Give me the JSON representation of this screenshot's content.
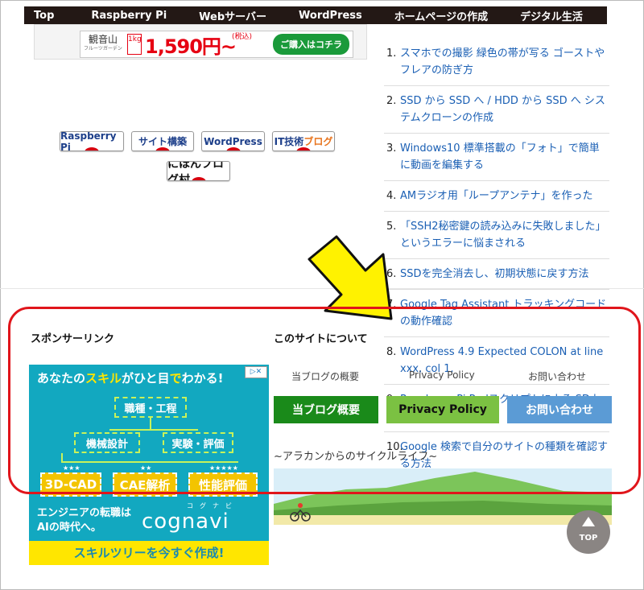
{
  "nav": {
    "items": [
      "Top",
      "Raspberry Pi",
      "Webサーバー",
      "WordPress",
      "ホームページの作成",
      "デジタル生活"
    ]
  },
  "top_ad": {
    "brand": "観音山",
    "brand_sub": "フルーツガーデン",
    "unit": "1kg",
    "price": "1,590円~",
    "tax": "(税込)",
    "buy_button": "ご購入はコチラ"
  },
  "badges": [
    "Raspberry Pi",
    "サイト構築",
    "WordPress",
    "IT技術",
    "ブログ",
    "にほんブログ村"
  ],
  "ranking": [
    {
      "num": "1.",
      "text": "スマホでの撮影 緑色の帯が写る ゴーストやフレアの防ぎ方"
    },
    {
      "num": "2.",
      "text": "SSD から SSD へ / HDD から SSD へ システムクローンの作成"
    },
    {
      "num": "3.",
      "text": "Windows10 標準搭載の「フォト」で簡単に動画を編集する"
    },
    {
      "num": "4.",
      "text": "AMラジオ用「ループアンテナ」を作った"
    },
    {
      "num": "5.",
      "text": "「SSH2秘密鍵の読み込みに失敗しました」というエラーに悩まされる"
    },
    {
      "num": "6.",
      "text": "SSDを完全消去し、初期状態に戻す方法"
    },
    {
      "num": "7.",
      "text": "Google Tag Assistant トラッキングコードの動作確認"
    },
    {
      "num": "8.",
      "text": "WordPress 4.9 Expected COLON at line xxx, col 1."
    },
    {
      "num": "9.",
      "text": "Raspberry Pi Perlスクリプトによる SDカードの縮小"
    },
    {
      "num": "10.",
      "text": "Google 検索で自分のサイトの種類を確認する方法"
    }
  ],
  "sponsor": {
    "title": "スポンサーリンク",
    "ad": {
      "headline_pre": "あなたの",
      "headline_hl1": "スキル",
      "headline_mid": "がひと目",
      "headline_hl2": "で",
      "headline_post": "わかる!",
      "adchoice": "▷✕",
      "node_root": "職種・工程",
      "node_l": "機械設計",
      "node_r": "実験・評価",
      "leaf1": "3D-CAD",
      "leaf2": "CAE解析",
      "leaf3": "性能評価",
      "stars1": "★★★",
      "stars2": "★★",
      "stars3": "★★★★★",
      "cog_text1": "エンジニアの転職は",
      "cog_text2": "AIの時代へ。",
      "cog_logo": "cognavi",
      "cog_kana": "コグナビ",
      "cta": "スキルツリーを今すぐ作成!"
    }
  },
  "site": {
    "title": "このサイトについて",
    "links": [
      "当ブログの概要",
      "Privacy Policy",
      "お問い合わせ"
    ],
    "buttons": [
      {
        "label": "当ブログ概要",
        "color": "#1a8a1a"
      },
      {
        "label": "Privacy Policy",
        "color": "#7bc142"
      },
      {
        "label": "お問い合わせ",
        "color": "#5b9bd5"
      }
    ],
    "tagline": "~アラカンからのサイクルライフ~"
  },
  "top_button": "TOP",
  "colors": {
    "nav_bg": "#231815",
    "highlight_frame": "#e0151b",
    "arrow": "#fff200",
    "link": "#1a5fb4"
  }
}
